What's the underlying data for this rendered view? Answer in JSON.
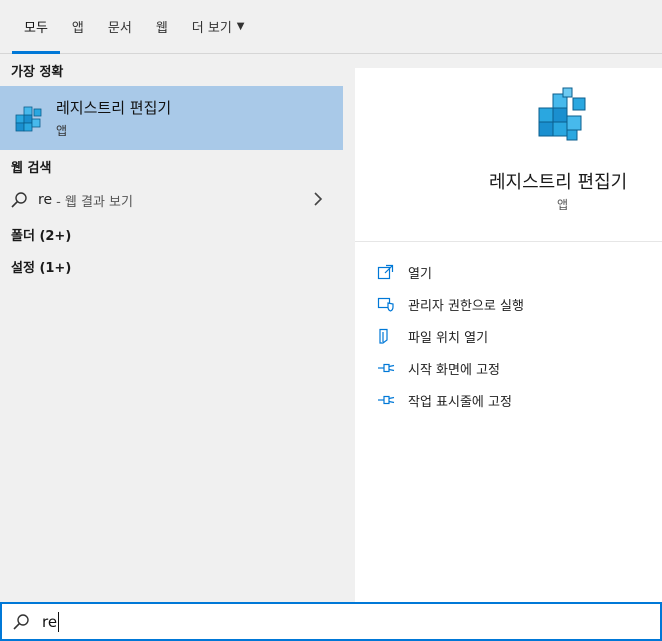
{
  "tabs": [
    {
      "label": "모두"
    },
    {
      "label": "앱"
    },
    {
      "label": "문서"
    },
    {
      "label": "웹"
    },
    {
      "label": "더 보기"
    }
  ],
  "left": {
    "best_match_heading": "가장 정확",
    "best_match": {
      "title": "레지스트리 편집기",
      "subtitle": "앱",
      "icon": "registry-editor-icon"
    },
    "web_heading": "웹 검색",
    "web_result": {
      "query": "re",
      "suffix": "- 웹 결과 보기"
    },
    "folders_heading": "폴더 (2+)",
    "settings_heading": "설정 (1+)"
  },
  "detail": {
    "title": "레지스트리 편집기",
    "kind": "앱",
    "actions": [
      {
        "label": "열기",
        "icon": "open-icon"
      },
      {
        "label": "관리자 권한으로 실행",
        "icon": "shield-icon"
      },
      {
        "label": "파일 위치 열기",
        "icon": "file-location-icon"
      },
      {
        "label": "시작 화면에 고정",
        "icon": "pin-icon"
      },
      {
        "label": "작업 표시줄에 고정",
        "icon": "pin-icon"
      }
    ]
  },
  "search": {
    "value": "re"
  },
  "colors": {
    "accent": "#0078d7",
    "selection": "#a9c9e8",
    "icon_blue": "#1a9bd7"
  }
}
